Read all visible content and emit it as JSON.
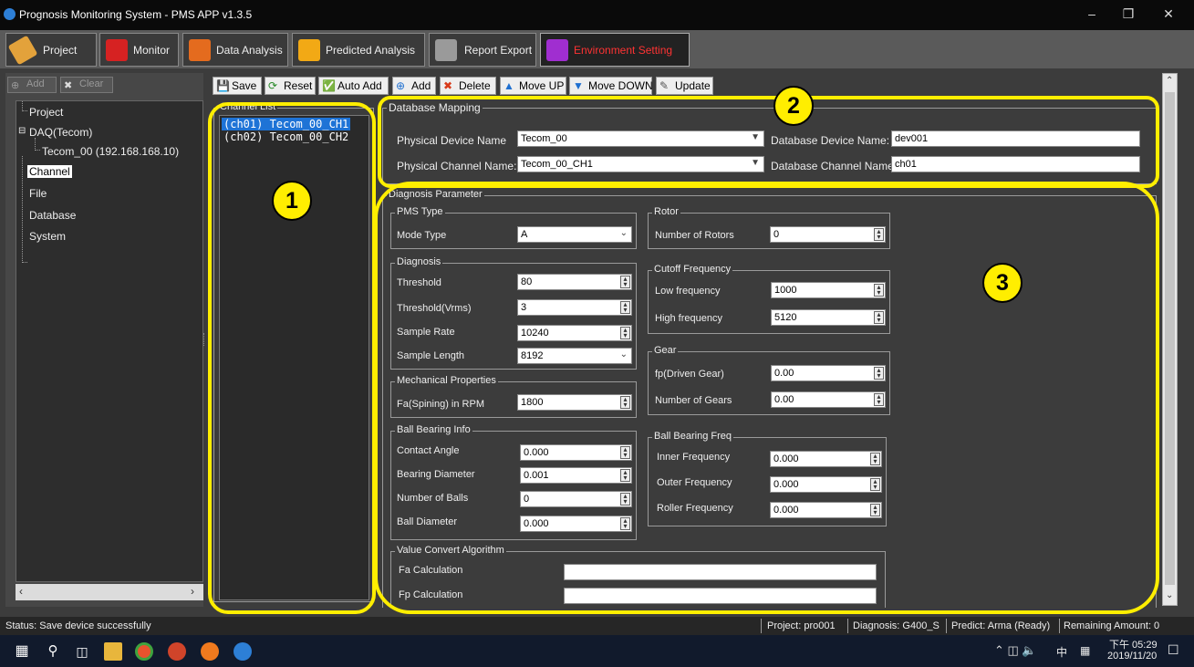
{
  "window": {
    "title": "Prognosis Monitoring System - PMS APP v1.3.5"
  },
  "tabs": [
    {
      "label": "Project"
    },
    {
      "label": "Monitor"
    },
    {
      "label": "Data Analysis"
    },
    {
      "label": "Predicted Analysis"
    },
    {
      "label": "Report Export"
    },
    {
      "label": "Environment Setting",
      "active": true
    }
  ],
  "left": {
    "add_label": "Add",
    "clear_label": "Clear",
    "tree": {
      "project": "Project",
      "daq": "DAQ(Tecom)",
      "device": "Tecom_00 (192.168.168.10)",
      "channel": "Channel",
      "file": "File",
      "database": "Database",
      "system": "System"
    }
  },
  "toolbar": {
    "save": "Save",
    "reset": "Reset",
    "auto_add": "Auto Add",
    "add": "Add",
    "delete": "Delete",
    "move_up": "Move UP",
    "move_down": "Move DOWN",
    "update": "Update"
  },
  "channel_list": {
    "title": "Channel List",
    "items": [
      "(ch01) Tecom_00_CH1",
      "(ch02) Tecom_00_CH2"
    ]
  },
  "db_mapping": {
    "title": "Database Mapping",
    "phys_device_label": "Physical Device Name",
    "phys_device_value": "Tecom_00",
    "phys_channel_label": "Physical Channel Name:",
    "phys_channel_value": "Tecom_00_CH1",
    "db_device_label": "Database Device Name:",
    "db_device_value": "dev001",
    "db_channel_label": "Database Channel Name:",
    "db_channel_value": "ch01"
  },
  "diagnosis": {
    "title": "Diagnosis Parameter",
    "pms_type": {
      "title": "PMS Type",
      "mode_label": "Mode Type",
      "mode_value": "A"
    },
    "diag": {
      "title": "Diagnosis",
      "threshold_label": "Threshold",
      "threshold_value": "80",
      "vrms_label": "Threshold(Vrms)",
      "vrms_value": "3",
      "rate_label": "Sample Rate",
      "rate_value": "10240",
      "length_label": "Sample Length",
      "length_value": "8192"
    },
    "mech": {
      "title": "Mechanical Properties",
      "fa_label": "Fa(Spining) in RPM",
      "fa_value": "1800"
    },
    "bearing": {
      "title": "Ball Bearing Info",
      "angle_label": "Contact Angle",
      "angle_value": "0.000",
      "bdiam_label": "Bearing Diameter",
      "bdiam_value": "0.001",
      "nballs_label": "Number of Balls",
      "nballs_value": "0",
      "balldiam_label": "Ball Diameter",
      "balldiam_value": "0.000"
    },
    "rotor": {
      "title": "Rotor",
      "num_label": "Number of Rotors",
      "num_value": "0"
    },
    "cutoff": {
      "title": "Cutoff Frequency",
      "low_label": "Low frequency",
      "low_value": "1000",
      "high_label": "High frequency",
      "high_value": "5120"
    },
    "gear": {
      "title": "Gear",
      "fp_label": "fp(Driven Gear)",
      "fp_value": "0.00",
      "num_label": "Number of Gears",
      "num_value": "0.00"
    },
    "freq": {
      "title": "Ball Bearing Freq",
      "inner_label": "Inner Frequency",
      "inner_value": "0.000",
      "outer_label": "Outer Frequency",
      "outer_value": "0.000",
      "roller_label": "Roller Frequency",
      "roller_value": "0.000"
    },
    "convert": {
      "title": "Value Convert Algorithm",
      "fa_label": "Fa Calculation",
      "fp_label": "Fp Calculation"
    }
  },
  "status": {
    "message": "Status:   Save device successfully",
    "project": "Project: pro001",
    "diagnosis": "Diagnosis: G400_S",
    "predict": "Predict: Arma (Ready)",
    "remaining": "Remaining Amount: 0"
  },
  "taskbar": {
    "time": "下午 05:29",
    "date": "2019/11/20",
    "ime": "中"
  },
  "annotations": [
    "1",
    "2",
    "3"
  ],
  "colors": {
    "highlight": "#ffee00",
    "selection": "#1e73d6",
    "active_tab_text": "#ff3333"
  }
}
